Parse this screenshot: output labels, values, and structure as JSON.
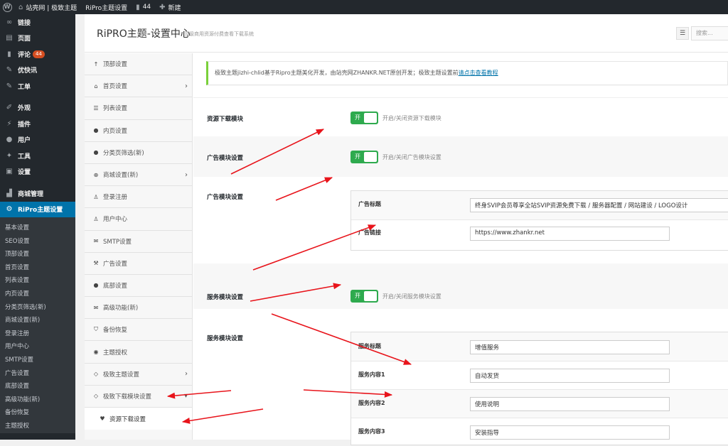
{
  "adminbar": {
    "site_name": "站壳网 | 极致主题",
    "theme_settings": "RiPro主题设置",
    "comments_count": "44",
    "new_label": "新建",
    "icons": {
      "wp": "wordpress-logo",
      "home": "home-icon",
      "comment": "comment-icon",
      "plus": "plus-icon"
    }
  },
  "menu": {
    "items": [
      {
        "label": "链接",
        "icon": "link-icon"
      },
      {
        "label": "页面",
        "icon": "page-icon"
      },
      {
        "label": "评论",
        "icon": "comment-icon",
        "badge": "44"
      },
      {
        "label": "优快讯",
        "icon": "pin-icon"
      },
      {
        "label": "工单",
        "icon": "pin-icon"
      },
      {
        "label": "外观",
        "icon": "brush-icon"
      },
      {
        "label": "插件",
        "icon": "plugin-icon"
      },
      {
        "label": "用户",
        "icon": "user-icon"
      },
      {
        "label": "工具",
        "icon": "wrench-icon"
      },
      {
        "label": "设置",
        "icon": "settings-icon"
      },
      {
        "label": "商城管理",
        "icon": "cart-icon"
      },
      {
        "label": "RiPro主题设置",
        "icon": "gear-icon"
      }
    ],
    "submenu": [
      "基本设置",
      "SEO设置",
      "顶部设置",
      "首页设置",
      "列表设置",
      "内页设置",
      "分类页筛选(新)",
      "商城设置(新)",
      "登录注册",
      "用户中心",
      "SMTP设置",
      "广告设置",
      "底部设置",
      "高级功能(新)",
      "备份恢复",
      "主题授权"
    ]
  },
  "header": {
    "title": "RiPRO主题-设置中心",
    "subtitle": "顶级商用资源付费查看下载系统",
    "search_placeholder": "搜索..."
  },
  "snav": {
    "items": [
      {
        "label": "顶部设置",
        "icon": "arrow-up-icon"
      },
      {
        "label": "首页设置",
        "icon": "home-icon",
        "chevron": true
      },
      {
        "label": "列表设置",
        "icon": "list-icon"
      },
      {
        "label": "内页设置",
        "icon": "dot-icon"
      },
      {
        "label": "分类页筛选(新)",
        "icon": "dot-icon"
      },
      {
        "label": "商城设置(新)",
        "icon": "plus-circle-icon",
        "chevron": true
      },
      {
        "label": "登录注册",
        "icon": "user-icon"
      },
      {
        "label": "用户中心",
        "icon": "user-icon"
      },
      {
        "label": "SMTP设置",
        "icon": "mail-icon"
      },
      {
        "label": "广告设置",
        "icon": "hammer-icon"
      },
      {
        "label": "底部设置",
        "icon": "dot-icon"
      },
      {
        "label": "高级功能(新)",
        "icon": "mail-icon"
      },
      {
        "label": "备份恢复",
        "icon": "shield-icon"
      },
      {
        "label": "主题授权",
        "icon": "eye-icon"
      },
      {
        "label": "极致主题设置",
        "icon": "diamond-icon",
        "chevron": true
      },
      {
        "label": "极致下载模块设置",
        "icon": "diamond-icon",
        "chevron_down": true
      }
    ],
    "active": {
      "label": "资源下载设置",
      "icon": "heart-icon"
    }
  },
  "notice": {
    "text": "极致主题jizhi-chlid基于Ripro主题美化开发，由站壳网ZHANKR.NET原创开发；极致主题设置前",
    "link": "请点击查看教程"
  },
  "settings": {
    "download": {
      "label": "资源下载模块",
      "switch": "开",
      "desc": "开启/关闭资源下载模块"
    },
    "ad_switch": {
      "label": "广告模块设置",
      "switch": "开",
      "desc": "开启/关闭广告模块设置"
    },
    "ad_group": {
      "label": "广告模块设置",
      "rows": [
        {
          "label": "广告标题",
          "value": "终身SVIP会员尊享全站SVIP资源免费下载 / 服务器配置 / 网站建设 / LOGO设计"
        },
        {
          "label": "广告链接",
          "value": "https://www.zhankr.net"
        }
      ]
    },
    "service_switch": {
      "label": "服务模块设置",
      "switch": "开",
      "desc": "开启/关闭服务模块设置"
    },
    "service_group": {
      "label": "服务模块设置",
      "rows": [
        {
          "label": "服务标题",
          "value": "增值服务"
        },
        {
          "label": "服务内容1",
          "value": "自动发货"
        },
        {
          "label": "服务内容2",
          "value": "使用说明"
        },
        {
          "label": "服务内容3",
          "value": "安装指导"
        }
      ]
    }
  },
  "colors": {
    "accent_blue": "#0073aa",
    "switch_green": "#2eaa4e",
    "arrow_red": "#e8141b",
    "badge": "#d54e21",
    "notice_green": "#7ad03a"
  }
}
